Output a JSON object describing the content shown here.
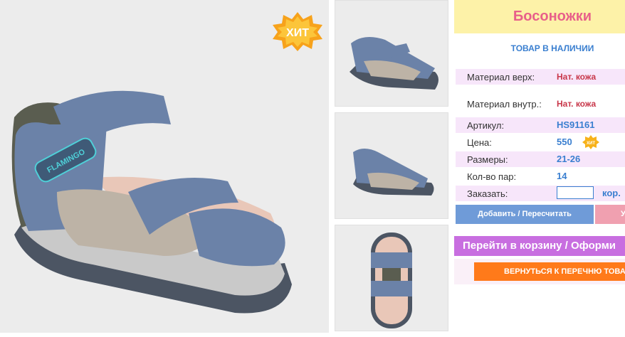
{
  "product": {
    "title": "Босоножки",
    "stock_status": "ТОВАР В НАЛИЧИИ",
    "hit_badge": "ХИТ",
    "mini_hit": "ХИТ",
    "brand_logo": "FLAMINGO"
  },
  "specs": [
    {
      "label": "Материал верх:",
      "value": "Нат. кожа"
    },
    {
      "label": "Материал внутр.:",
      "value": "Нат. кожа"
    },
    {
      "label": "Артикул:",
      "value": "HS91161"
    },
    {
      "label": "Цена:",
      "value": "550"
    },
    {
      "label": "Размеры:",
      "value": "21-26"
    },
    {
      "label": "Кол-во пар:",
      "value": "14"
    }
  ],
  "order": {
    "label": "Заказать:",
    "quantity": "",
    "unit": "кор."
  },
  "buttons": {
    "add": "Добавить / Пересчитать",
    "remove": "У",
    "cart": "Перейти в корзину / Оформи",
    "back": "ВЕРНУТЬСЯ К ПЕРЕЧНЮ ТОВА"
  },
  "colors": {
    "title_bg": "#fdf2a8",
    "title_text": "#e8608a",
    "accent_blue": "#3a7fd0",
    "spec_row_bg": "#f7e6fa",
    "add_button": "#6f9bd8",
    "cart_button": "#c86ee0",
    "back_button": "#ff7a1a"
  }
}
